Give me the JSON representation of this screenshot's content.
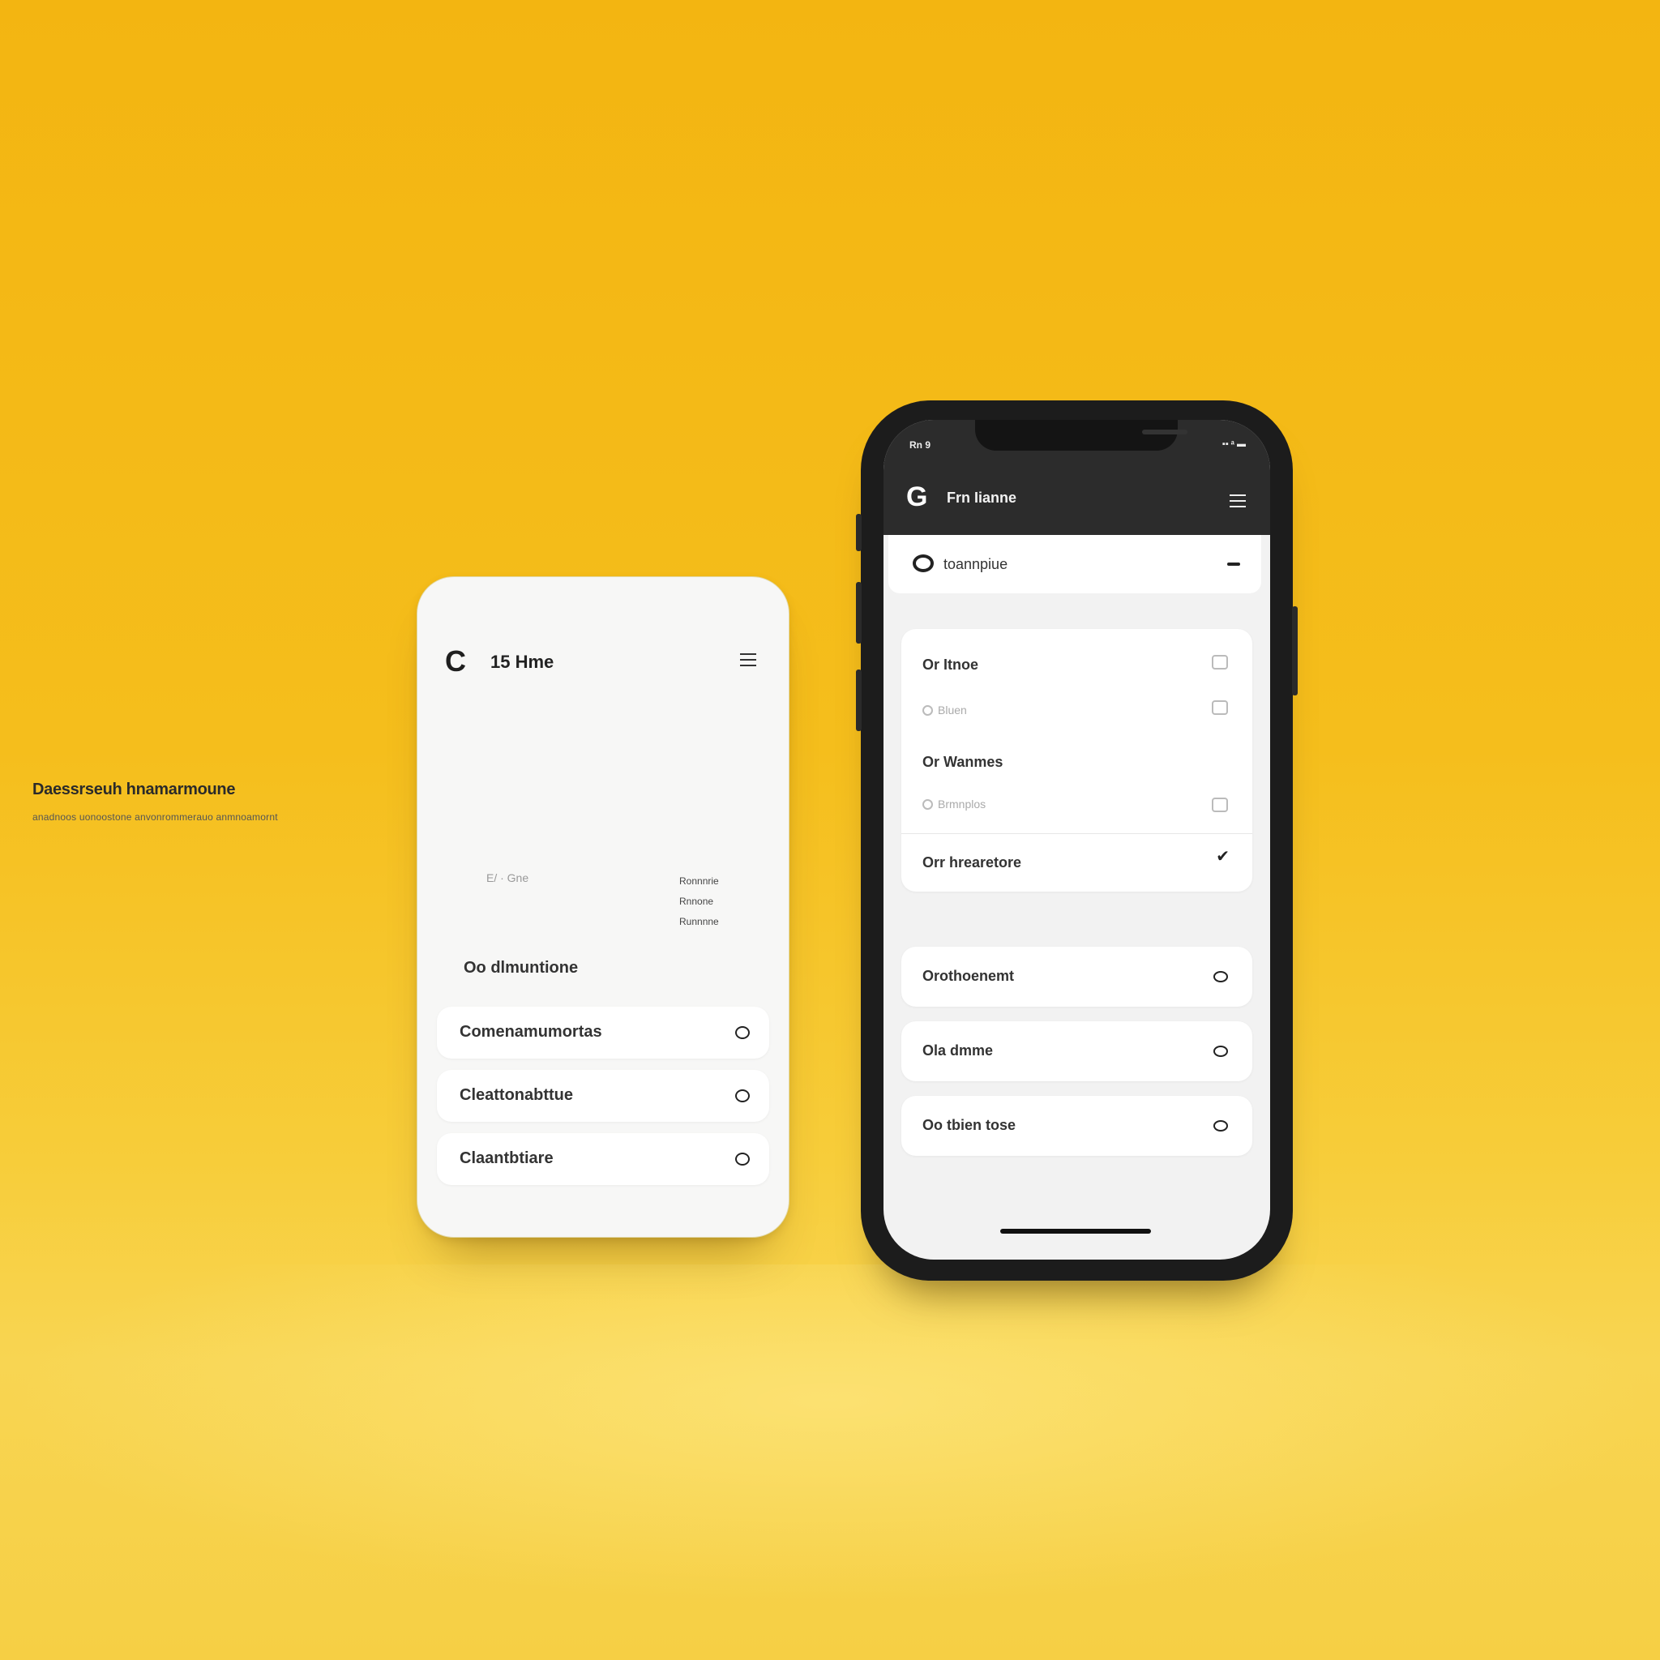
{
  "card": {
    "title": "15 Hme",
    "heading": "Daessrseuh hnamarmoune",
    "subtitle": "anadnoos uonoostone anvonrommerauo anmnoamornt",
    "meta_left": "E/ · Gne",
    "meta_list": [
      "Ronnnrie",
      "Rnnone",
      "Runnnne"
    ],
    "section_title": "Oo dlmuntione",
    "rows": [
      {
        "label": "Comenamumortas"
      },
      {
        "label": "Cleattonabttue"
      },
      {
        "label": "Claantbtiare"
      }
    ]
  },
  "phone": {
    "status": {
      "time": "Rn 9",
      "icons": "▪▪ ᵃ ▬"
    },
    "nav": {
      "logo": "G",
      "title": "Frn Iianne"
    },
    "search": {
      "label": "toannpiue"
    },
    "options": [
      {
        "label": "Or Itnoe",
        "sub": "Bluen"
      },
      {
        "label": "Or Wanmes",
        "sub": "Brmnplos"
      }
    ],
    "selected_option": "Orr hrearetore",
    "rows": [
      {
        "label": "Orothoenemt"
      },
      {
        "label": "Ola dmme"
      },
      {
        "label": "Oo tbien tose"
      }
    ]
  }
}
